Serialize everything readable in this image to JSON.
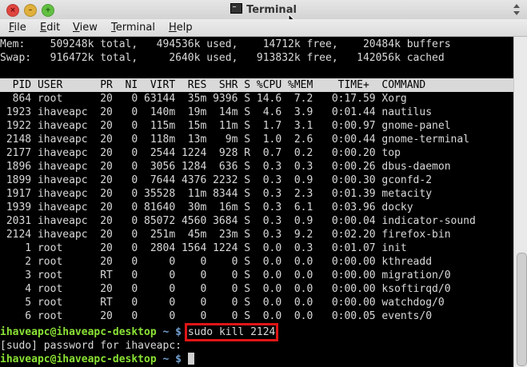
{
  "window": {
    "title": "Terminal",
    "close_glyph": "×",
    "min_glyph": "–",
    "max_glyph": "+"
  },
  "menu": [
    {
      "key": "F",
      "rest": "ile"
    },
    {
      "key": "E",
      "rest": "dit"
    },
    {
      "key": "V",
      "rest": "iew"
    },
    {
      "key": "T",
      "rest": "erminal"
    },
    {
      "key": "H",
      "rest": "elp"
    }
  ],
  "summary": {
    "mem": "Mem:    509248k total,   494536k used,    14712k free,    20484k buffers",
    "swap": "Swap:   916472k total,     2640k used,   913832k free,   142056k cached"
  },
  "top_header": "  PID USER      PR  NI  VIRT  RES  SHR S %CPU %MEM    TIME+  COMMAND",
  "processes": [
    "  864 root      20   0 63144  35m 9396 S 14.6  7.2   0:17.59 Xorg",
    " 1923 ihaveapc  20   0  140m  19m  14m S  4.6  3.9   0:01.44 nautilus",
    " 1922 ihaveapc  20   0  115m  15m  11m S  1.7  3.1   0:00.97 gnome-panel",
    " 2148 ihaveapc  20   0  118m  13m   9m S  1.0  2.6   0:00.44 gnome-terminal",
    " 2177 ihaveapc  20   0  2544 1224  928 R  0.7  0.2   0:00.20 top",
    " 1896 ihaveapc  20   0  3056 1284  636 S  0.3  0.3   0:00.26 dbus-daemon",
    " 1899 ihaveapc  20   0  7644 4376 2232 S  0.3  0.9   0:00.30 gconfd-2",
    " 1917 ihaveapc  20   0 35528  11m 8344 S  0.3  2.3   0:01.39 metacity",
    " 1939 ihaveapc  20   0 81640  30m  16m S  0.3  6.1   0:03.96 docky",
    " 2031 ihaveapc  20   0 85072 4560 3684 S  0.3  0.9   0:00.04 indicator-sound",
    " 2124 ihaveapc  20   0  251m  45m  23m S  0.3  9.2   0:02.20 firefox-bin",
    "    1 root      20   0  2804 1564 1224 S  0.0  0.3   0:01.07 init",
    "    2 root      20   0     0    0    0 S  0.0  0.0   0:00.00 kthreadd",
    "    3 root      RT   0     0    0    0 S  0.0  0.0   0:00.00 migration/0",
    "    4 root      20   0     0    0    0 S  0.0  0.0   0:00.00 ksoftirqd/0",
    "    5 root      RT   0     0    0    0 S  0.0  0.0   0:00.00 watchdog/0",
    "    6 root      20   0     0    0    0 S  0.0  0.0   0:00.05 events/0"
  ],
  "prompt": {
    "user_host": "ihaveapc@ihaveapc-desktop",
    "dir": " ~ ",
    "symbol": "$",
    "command": "sudo kill 2124",
    "sudo_prompt": "[sudo] password for ihaveapc:"
  }
}
